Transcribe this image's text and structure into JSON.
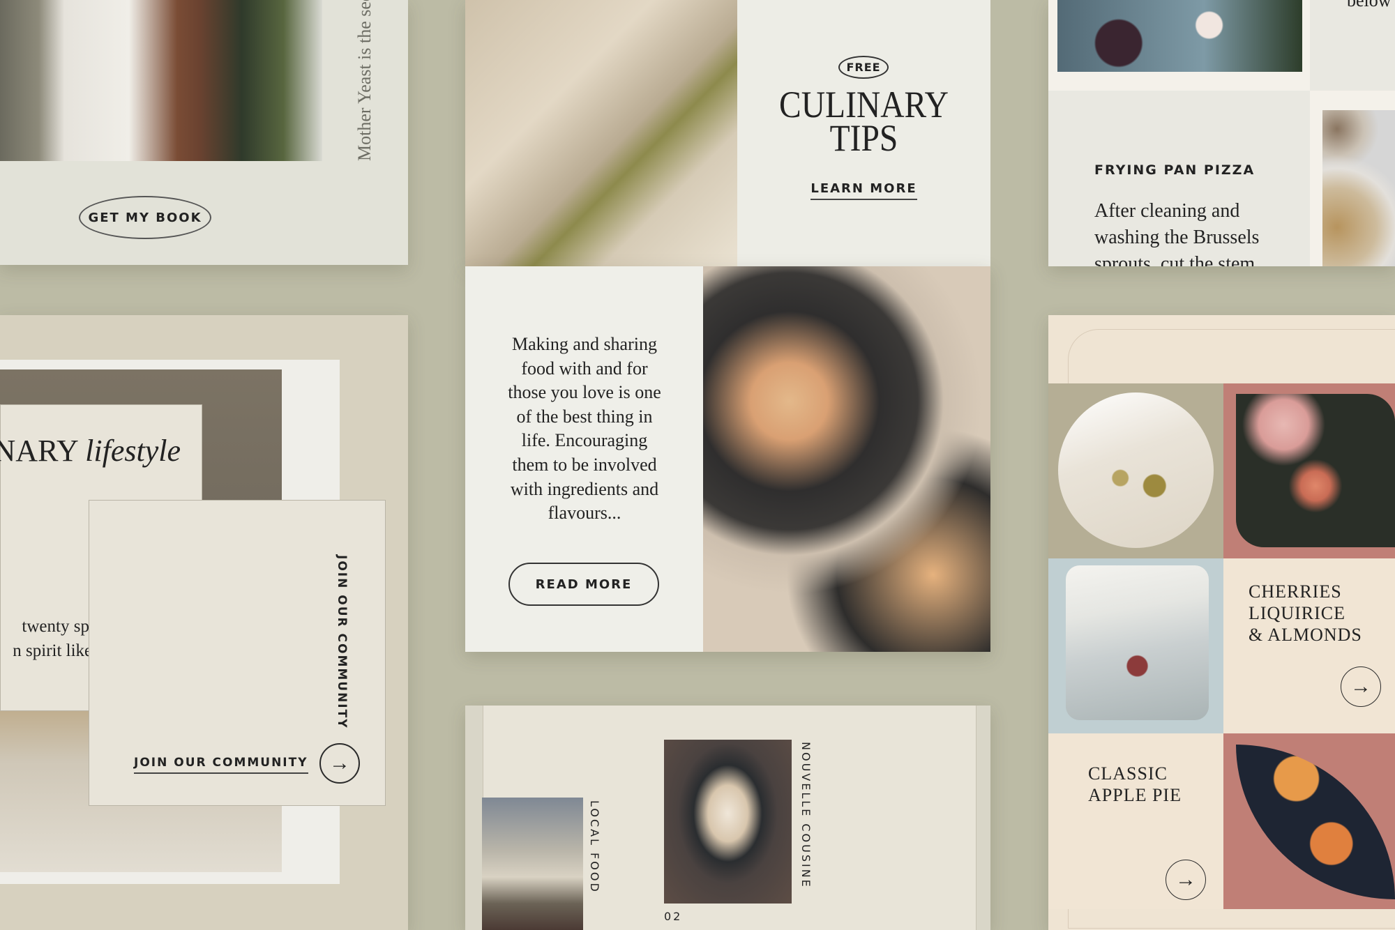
{
  "colors": {
    "background": "#bcbba5",
    "ink": "#222222",
    "rose": "#c07f76",
    "sage": "#b5ae95",
    "mist": "#c0cfd2",
    "cream": "#efe4d3"
  },
  "card_book": {
    "vertical_text": "Mother Yeast is the secr",
    "button": "GET MY BOOK"
  },
  "card_lifestyle": {
    "headline_upright": "NARY",
    "headline_italic": "lifestyle",
    "body_lines": [
      "twenty spring of in",
      "n spirit likely estate."
    ],
    "vertical_label": "JOIN OUR COMMUNITY",
    "link": "JOIN OUR COMMUNITY",
    "arrow_icon": "arrow-right-icon"
  },
  "card_tips": {
    "badge": "FREE",
    "title_line1": "CULINARY",
    "title_line2": "TIPS",
    "link": "LEARN MORE"
  },
  "card_sharing": {
    "body": "Making and sharing food with and for those you love is one of the best thing in life. Encouraging them to be involved with ingredients and flavours...",
    "button": "READ MORE"
  },
  "card_local": {
    "label_left": "LOCAL FOOD",
    "label_right": "NOUVELLE COUSINE",
    "page_number": "02"
  },
  "card_pizza": {
    "corner_text": "below",
    "title": "FRYING PAN PIZZA",
    "body_lines": [
      "After cleaning and",
      "washing the Brussels",
      "sprouts, cut the stem"
    ]
  },
  "card_grid": {
    "title1_lines": [
      "CHERRIES",
      "LIQUIRICE",
      "& ALMONDS"
    ],
    "title2_lines": [
      "CLASSIC",
      "APPLE PIE"
    ],
    "arrow_icon": "arrow-right-icon"
  }
}
